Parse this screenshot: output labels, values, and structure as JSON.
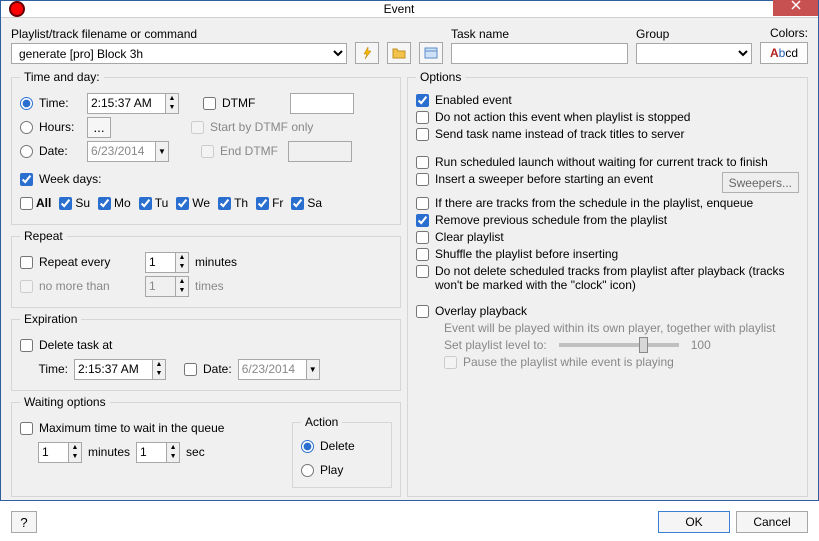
{
  "window": {
    "title": "Event"
  },
  "top": {
    "filename_label": "Playlist/track filename or command",
    "filename_value": "generate [pro] Block 3h",
    "taskname_label": "Task name",
    "taskname_value": "",
    "group_label": "Group",
    "group_value": "",
    "colors_label": "Colors:",
    "colors_button": "Abcd"
  },
  "time_and_day": {
    "legend": "Time and day:",
    "time_label": "Time:",
    "time_value": "2:15:37 AM",
    "dtmf_label": "DTMF",
    "dtmf_value": "",
    "hours_label": "Hours:",
    "hours_btn": "...",
    "start_dtmf_label": "Start by DTMF only",
    "date_label": "Date:",
    "date_value": "6/23/2014",
    "end_dtmf_label": "End DTMF",
    "end_dtmf_value": "",
    "weekdays_label": "Week days:",
    "all_label": "All",
    "days": [
      "Su",
      "Mo",
      "Tu",
      "We",
      "Th",
      "Fr",
      "Sa"
    ]
  },
  "repeat": {
    "legend": "Repeat",
    "every_label": "Repeat every",
    "every_value": "1",
    "every_unit": "minutes",
    "nomore_label": "no more than",
    "nomore_value": "1",
    "nomore_unit": "times"
  },
  "expiration": {
    "legend": "Expiration",
    "delete_label": "Delete task at",
    "time_label": "Time:",
    "time_value": "2:15:37 AM",
    "date_label": "Date:",
    "date_value": "6/23/2014"
  },
  "waiting": {
    "legend": "Waiting options",
    "max_label": "Maximum time to wait in the queue",
    "min_value": "1",
    "min_unit": "minutes",
    "sec_value": "1",
    "sec_unit": "sec",
    "action_legend": "Action",
    "delete_label": "Delete",
    "play_label": "Play"
  },
  "options": {
    "legend": "Options",
    "enabled": "Enabled event",
    "noaction": "Do not action this event when playlist is stopped",
    "sendtask": "Send task name instead of track titles to server",
    "runsched": "Run scheduled launch without waiting for current track to finish",
    "sweeper": "Insert a sweeper before starting an event",
    "sweepers_btn": "Sweepers...",
    "enqueue": "If there are tracks from the schedule in the playlist, enqueue",
    "removeprev": "Remove previous schedule from the playlist",
    "clear": "Clear playlist",
    "shuffle": "Shuffle the playlist before inserting",
    "nodel": "Do not delete scheduled tracks from playlist after playback (tracks won't be marked with the \"clock\" icon)",
    "overlay": "Overlay playback",
    "overlay_hint": "Event will be played within its own player, together with playlist",
    "setlevel": "Set playlist level to:",
    "level_value": "100",
    "pause": "Pause the playlist while event is playing"
  },
  "footer": {
    "help": "?",
    "ok": "OK",
    "cancel": "Cancel"
  }
}
